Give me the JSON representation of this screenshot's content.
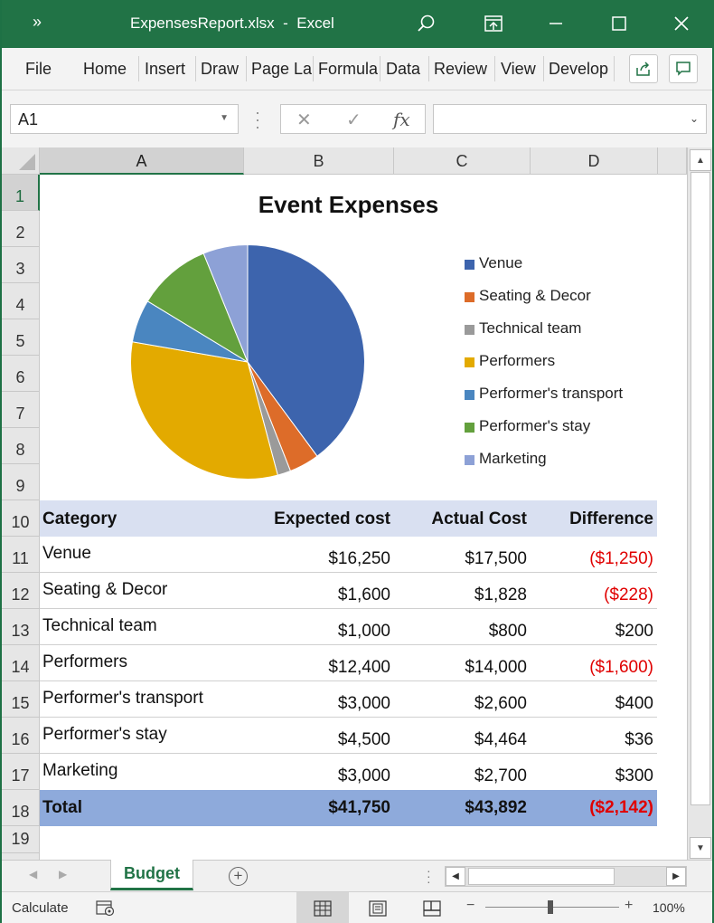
{
  "window": {
    "title": "ExpensesReport.xlsx  -  Excel",
    "more_label": "»"
  },
  "ribbon": {
    "tabs": [
      "File",
      "Home",
      "Insert",
      "Draw",
      "Page La",
      "Formula",
      "Data",
      "Review",
      "View",
      "Develop"
    ]
  },
  "formula_bar": {
    "name_box": "A1",
    "fx_label": "fx",
    "formula": ""
  },
  "columns": [
    "A",
    "B",
    "C",
    "D"
  ],
  "rows": [
    "1",
    "2",
    "3",
    "4",
    "5",
    "6",
    "7",
    "8",
    "9",
    "10",
    "11",
    "12",
    "13",
    "14",
    "15",
    "16",
    "17",
    "18",
    "19"
  ],
  "chart_data": {
    "type": "pie",
    "title": "Event Expenses",
    "legend_position": "right",
    "categories": [
      "Venue",
      "Seating & Decor",
      "Technical team",
      "Performers",
      "Performer's transport",
      "Performer's stay",
      "Marketing"
    ],
    "values": [
      17500,
      1828,
      800,
      14000,
      2600,
      4464,
      2700
    ],
    "colors": [
      "#3d64ad",
      "#dd6c29",
      "#9a9a9a",
      "#e3aa00",
      "#4a86c0",
      "#63a03d",
      "#8da1d6"
    ]
  },
  "table": {
    "headers": [
      "Category",
      "Expected cost",
      "Actual Cost",
      "Difference"
    ],
    "rows": [
      [
        "Venue",
        "$16,250",
        "$17,500",
        "($1,250)"
      ],
      [
        "Seating & Decor",
        "$1,600",
        "$1,828",
        "($228)"
      ],
      [
        "Technical team",
        "$1,000",
        "$800",
        "$200"
      ],
      [
        "Performers",
        "$12,400",
        "$14,000",
        "($1,600)"
      ],
      [
        "Performer's transport",
        "$3,000",
        "$2,600",
        "$400"
      ],
      [
        "Performer's stay",
        "$4,500",
        "$4,464",
        "$36"
      ],
      [
        "Marketing",
        "$3,000",
        "$2,700",
        "$300"
      ]
    ],
    "total": [
      "Total",
      "$41,750",
      "$43,892",
      "($2,142)"
    ],
    "negative_color": "#e00000"
  },
  "sheets": {
    "active": "Budget"
  },
  "status": {
    "mode": "Calculate",
    "zoom": "100%",
    "zoom_out": "−",
    "zoom_in": "+"
  }
}
